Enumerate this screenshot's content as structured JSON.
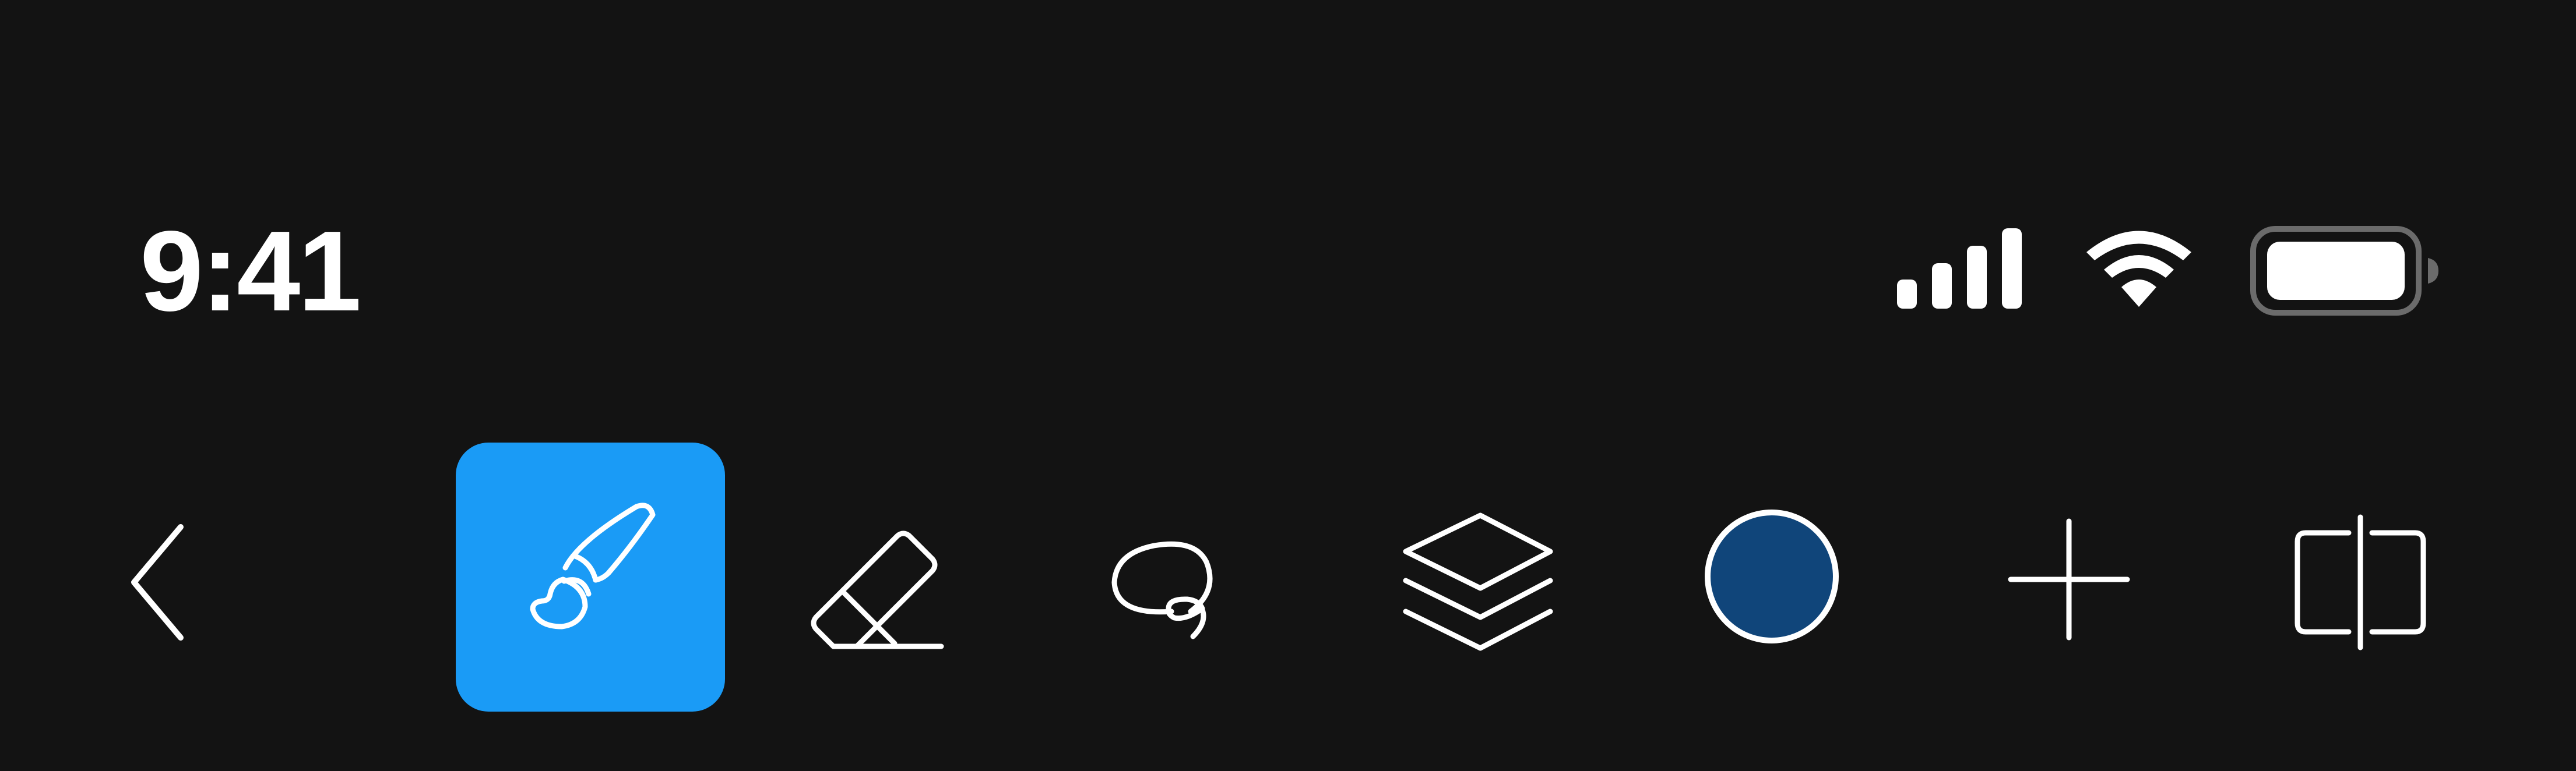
{
  "status_bar": {
    "time": "9:41",
    "icons": {
      "signal": "cellular-signal-icon",
      "wifi": "wifi-icon",
      "battery": "battery-icon"
    },
    "signal_bars_active": 4,
    "battery_level": 1.0
  },
  "toolbar": {
    "selected_tool": "brush",
    "tools": [
      {
        "id": "back",
        "icon": "chevron-left-icon"
      },
      {
        "id": "brush",
        "icon": "paintbrush-icon",
        "selected": true
      },
      {
        "id": "eraser",
        "icon": "eraser-icon"
      },
      {
        "id": "lasso",
        "icon": "lasso-icon"
      },
      {
        "id": "layers",
        "icon": "layers-icon"
      },
      {
        "id": "color",
        "icon": "color-swatch"
      },
      {
        "id": "add",
        "icon": "plus-icon"
      },
      {
        "id": "split",
        "icon": "split-view-icon"
      }
    ],
    "current_color": "#10457A"
  },
  "colors": {
    "background": "#131313",
    "accent": "#1A9BF6",
    "icon": "#FFFFFF",
    "battery_frame": "#6B6B6B"
  }
}
